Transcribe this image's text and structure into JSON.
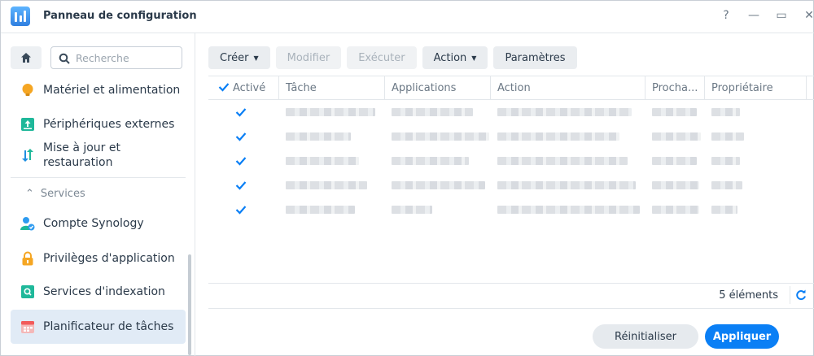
{
  "window": {
    "title": "Panneau de configuration",
    "controls": {
      "help": "?",
      "minimize": "—",
      "maximize": "▭",
      "close": "✕"
    }
  },
  "sidebar": {
    "search_placeholder": "Recherche",
    "items_top": [
      {
        "label": "Matériel et alimentation",
        "icon": "bulb-icon",
        "color": "#f5a623"
      },
      {
        "label": "Périphériques externes",
        "icon": "external-device-icon",
        "color": "#1fb89a"
      },
      {
        "label": "Mise à jour et restauration",
        "icon": "refresh-update-icon",
        "color": "#1e8fe1"
      }
    ],
    "section": {
      "label": "Services",
      "expanded": true
    },
    "items_services": [
      {
        "label": "Compte Synology",
        "icon": "synology-account-icon",
        "color": "#2e9bf0",
        "active": false
      },
      {
        "label": "Privilèges d'application",
        "icon": "lock-icon",
        "color": "#f5a623",
        "active": false
      },
      {
        "label": "Services d'indexation",
        "icon": "indexing-icon",
        "color": "#1fb89a",
        "active": false
      },
      {
        "label": "Planificateur de tâches",
        "icon": "calendar-icon",
        "color": "#f25b5b",
        "active": true
      }
    ]
  },
  "toolbar": {
    "create": "Créer",
    "modify": "Modifier",
    "run": "Exécuter",
    "action": "Action",
    "settings": "Paramètres"
  },
  "table": {
    "columns": [
      "Activé",
      "Tâche",
      "Applications",
      "Action",
      "Procha...",
      "Propriétaire"
    ],
    "rows": [
      {
        "enabled": true
      },
      {
        "enabled": true
      },
      {
        "enabled": true
      },
      {
        "enabled": true
      },
      {
        "enabled": true
      }
    ],
    "count_label": "5 éléments"
  },
  "footer": {
    "reset": "Réinitialiser",
    "apply": "Appliquer"
  },
  "colors": {
    "accent": "#0a7ff5",
    "active_item_bg": "#e1ebf6"
  }
}
